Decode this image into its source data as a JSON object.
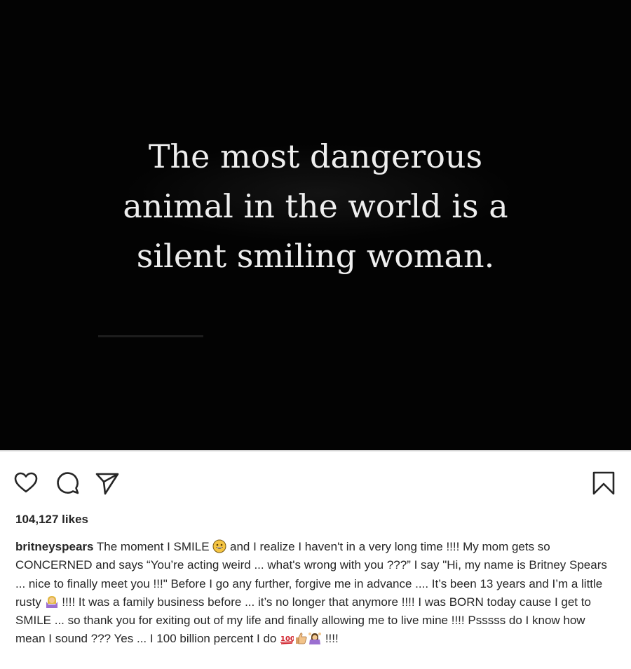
{
  "post": {
    "quote_lines": [
      "The most dangerous",
      "animal in the world is a",
      "silent smiling woman."
    ]
  },
  "actions": {
    "like": "heart-icon",
    "comment": "comment-bubble-icon",
    "share": "send-paper-plane-icon",
    "save": "bookmark-icon"
  },
  "likes_text": "104,127 likes",
  "caption": {
    "username": "britneyspears",
    "part1": " The moment I SMILE ",
    "part2": " and I realize I haven't in a very long time !!!! My mom gets so CONCERNED and says “You’re acting weird ... what's wrong with you ???”  I say \"Hi, my name is Britney Spears ... nice to finally meet you !!!\" Before I go any further, forgive me in advance .... It’s been 13 years and I’m a little rusty ",
    "part3": " !!!! It was a family business before ... it’s no longer that anymore !!!! I was BORN today cause I get to SMILE ... so thank you for exiting out of my life and finally allowing me to live mine !!!! Psssss do I know how mean I sound ??? Yes ... I 100 billion percent I do ",
    "part4": " !!!!",
    "emojis": [
      "grinning-face-icon",
      "shrugging-woman-icon",
      "hundred-points-icon",
      "thumbs-up-icon",
      "woman-raising-hands-icon"
    ]
  },
  "colors": {
    "image_bg": "#030303",
    "quote_text": "#eeeeee",
    "text": "#262626"
  }
}
